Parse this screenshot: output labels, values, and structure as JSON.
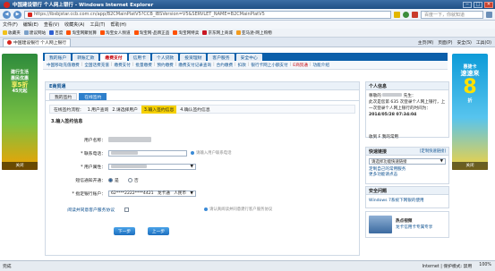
{
  "window": {
    "title": "中国建设银行 个人网上银行 - Windows Internet Explorer",
    "minimize": "─",
    "maximize": "□",
    "close": "✕"
  },
  "address_bar": {
    "back": "◀",
    "forward": "▶",
    "url": "https://ibsbjstar.ccb.com.cn/app/B2CMainPlatV5?CCB_IBSVersion=V5&SERVLET_NAME=B2CMainPlatV5",
    "search_placeholder": "百度一下，你就知道"
  },
  "menu_bar": {
    "items": [
      "文件(F)",
      "编辑(E)",
      "查看(V)",
      "收藏夹(A)",
      "工具(T)",
      "帮助(H)"
    ]
  },
  "favorites_bar": {
    "label": "收藏夹",
    "items": [
      "建议网站",
      "百度",
      "淘宝网聚划算",
      "淘宝女人频道",
      "淘宝网-品牌正品",
      "淘宝网特卖",
      "京东网上商城",
      "亚马逊-网上购物"
    ]
  },
  "tab_bar": {
    "tab_label": "中国建设银行 个人网上银行",
    "tools": [
      "主页(M)",
      "页面(P)",
      "安全(S)",
      "工具(O)"
    ]
  },
  "left_ad": {
    "line1": "建行生活",
    "line2": "惠民优惠",
    "line3": "享5折",
    "line4": "45元起",
    "close": "关闭"
  },
  "right_ad": {
    "line1": "惠捷卡",
    "line2": "速速来",
    "line3": "8",
    "line4": "折",
    "close": "关闭"
  },
  "main_nav": {
    "items": [
      "我的账户",
      "转账汇款",
      "缴费支付",
      "信用卡",
      "个人贷款",
      "投资理财",
      "客户服务",
      "安全中心"
    ],
    "active_index": 2
  },
  "sub_nav": {
    "items": [
      "中国移动充值缴费",
      "全国话费充值",
      "缴费支付",
      "批量缴费",
      "预约缴费",
      "缴费支付记录查询",
      "合约缴费",
      "扣款",
      "银行卡网上小额支付",
      "E商贸通",
      "功能介绍"
    ],
    "active_index": 9
  },
  "content": {
    "panel_title": "E商贸通",
    "inner_tabs": [
      "我的签约",
      "在线签约"
    ],
    "steps": [
      "在线签约流程：",
      "1.用户查询",
      "2.请选择用户",
      "3.输入签约信息",
      "4.确认签约信息"
    ],
    "section_title": "3.输入签约信息",
    "fields": {
      "username_label": "用户名称：",
      "phone_label": "* 联系电话：",
      "phone_hint": "请输入用户联系电话",
      "attr_label": "* 用户属性：",
      "attr_value": "",
      "sms_label": "短信通知开通：",
      "sms_yes": "是",
      "sms_no": "否",
      "account_label": "* 指定银行账户：",
      "account_number": "62****2222****4421",
      "account_type": "龙卡通",
      "account_currency": "人民币",
      "agreement_label": "阅读并同意客户服务协议",
      "agreement_hint": "请认真阅读并同意建行客户服务协议"
    },
    "buttons": {
      "next": "下一步",
      "prev": "上一步"
    }
  },
  "right_panel": {
    "user_info_title": "个人信息",
    "greeting": "尊敬的",
    "greeting_suffix": "先生：",
    "login_text": "此次是您第 635 次登录个人网上银行，上一次登录个人网上银行的时间为：",
    "login_time": "2014/05/28 07:34:04",
    "favorite_link": "收到 F 我的常用",
    "quick_title": "快速链接",
    "quick_more": "[定制快速链接]",
    "quick_select": "请选择功能快速链接",
    "quick_link1": "定制自己的常用服务",
    "quick_link2": "更多功能请点击",
    "security_title": "安全问题",
    "security_link": "Windows 7系统下网银的使用",
    "video_title": "热点视频",
    "video_text": "龙卡信用卡专属专享"
  },
  "status_bar": {
    "text": "完成",
    "zone": "Internet | 保护模式: 禁用",
    "zoom": "100%"
  }
}
